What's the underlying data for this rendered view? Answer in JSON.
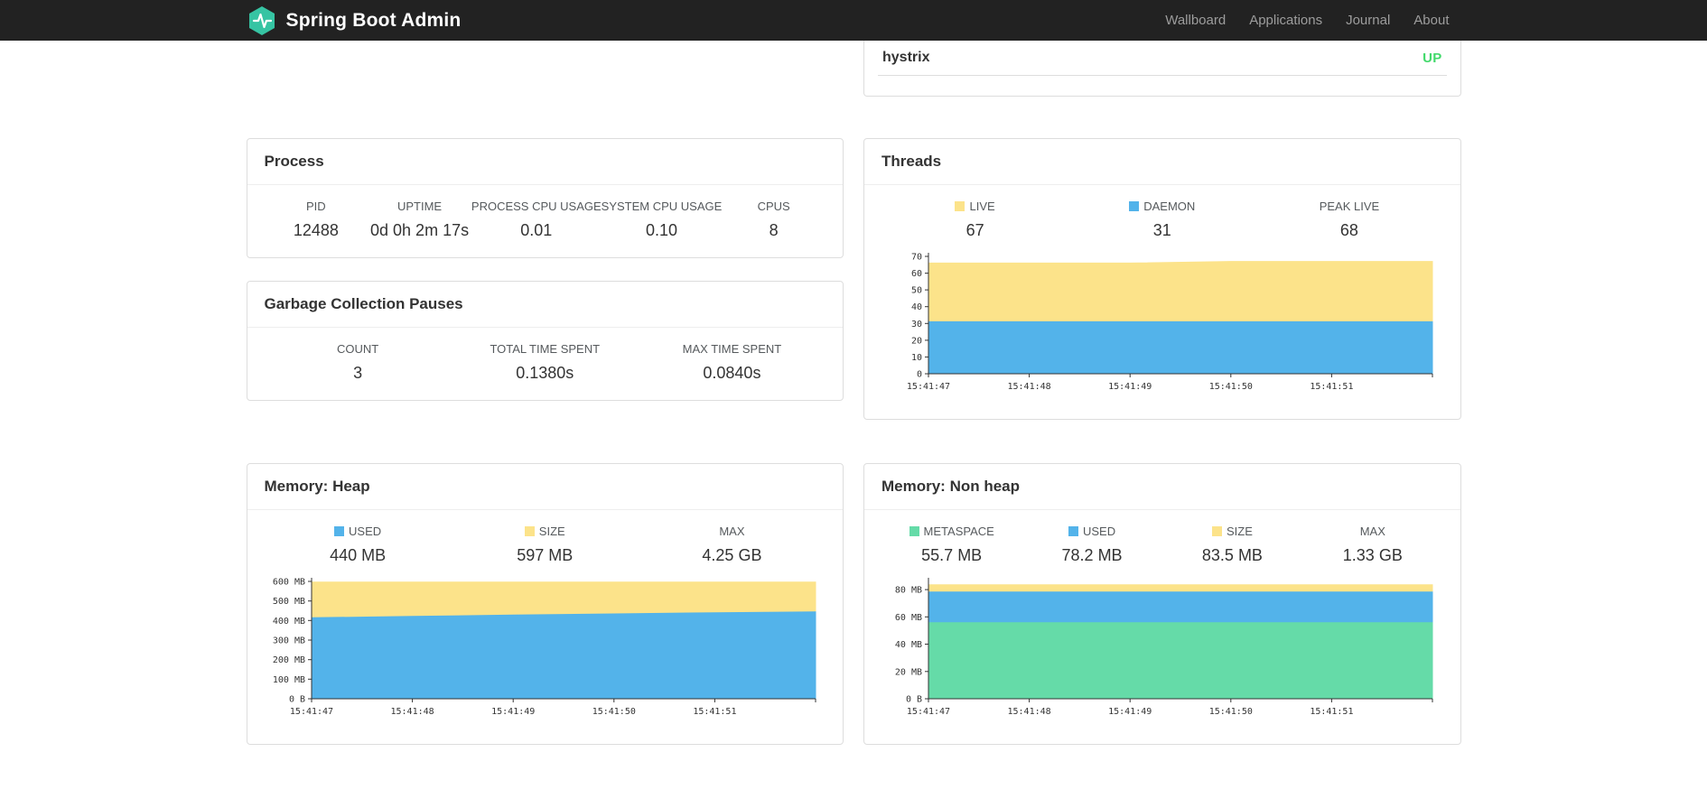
{
  "navbar": {
    "brand": "Spring Boot Admin",
    "logo_color": "#36c4a3",
    "items": [
      {
        "label": "Wallboard"
      },
      {
        "label": "Applications"
      },
      {
        "label": "Journal"
      },
      {
        "label": "About"
      }
    ]
  },
  "application_status": {
    "name": "hystrix",
    "status": "UP",
    "status_color": "#42d96b"
  },
  "cards": {
    "process": {
      "title": "Process",
      "metrics": [
        {
          "label": "PID",
          "value": "12488"
        },
        {
          "label": "UPTIME",
          "value": "0d 0h 2m 17s"
        },
        {
          "label": "PROCESS CPU USAGE",
          "value": "0.01"
        },
        {
          "label": "SYSTEM CPU USAGE",
          "value": "0.10"
        },
        {
          "label": "CPUS",
          "value": "8"
        }
      ]
    },
    "gc": {
      "title": "Garbage Collection Pauses",
      "metrics": [
        {
          "label": "COUNT",
          "value": "3"
        },
        {
          "label": "TOTAL TIME SPENT",
          "value": "0.1380s"
        },
        {
          "label": "MAX TIME SPENT",
          "value": "0.0840s"
        }
      ]
    },
    "threads": {
      "title": "Threads",
      "legend": [
        {
          "label": "LIVE",
          "value": "67",
          "color": "#fce38a"
        },
        {
          "label": "DAEMON",
          "value": "31",
          "color": "#53b3ea"
        },
        {
          "label": "PEAK LIVE",
          "value": "68"
        }
      ]
    },
    "heap": {
      "title": "Memory: Heap",
      "legend": [
        {
          "label": "USED",
          "value": "440 MB",
          "color": "#53b3ea"
        },
        {
          "label": "SIZE",
          "value": "597 MB",
          "color": "#fce38a"
        },
        {
          "label": "MAX",
          "value": "4.25 GB"
        }
      ]
    },
    "nonheap": {
      "title": "Memory: Non heap",
      "legend": [
        {
          "label": "METASPACE",
          "value": "55.7 MB",
          "color": "#65dba8"
        },
        {
          "label": "USED",
          "value": "78.2 MB",
          "color": "#53b3ea"
        },
        {
          "label": "SIZE",
          "value": "83.5 MB",
          "color": "#fce38a"
        },
        {
          "label": "MAX",
          "value": "1.33 GB"
        }
      ]
    }
  },
  "chart_data": [
    {
      "id": "threads",
      "type": "area",
      "title": "Threads",
      "xlabel": "",
      "ylabel": "",
      "ylim": [
        0,
        70
      ],
      "grid": false,
      "legend_position": "top",
      "x": [
        "15:41:47",
        "15:41:48",
        "15:41:49",
        "15:41:50",
        "15:41:51"
      ],
      "yticks": [
        {
          "v": 0,
          "label": "0"
        },
        {
          "v": 10,
          "label": "10"
        },
        {
          "v": 20,
          "label": "20"
        },
        {
          "v": 30,
          "label": "30"
        },
        {
          "v": 40,
          "label": "40"
        },
        {
          "v": 50,
          "label": "50"
        },
        {
          "v": 60,
          "label": "60"
        },
        {
          "v": 70,
          "label": "70"
        }
      ],
      "series": [
        {
          "name": "LIVE",
          "color": "#fce38a",
          "values": [
            66,
            66,
            66,
            67,
            67,
            67
          ]
        },
        {
          "name": "DAEMON",
          "color": "#53b3ea",
          "values": [
            31,
            31,
            31,
            31,
            31,
            31
          ]
        }
      ]
    },
    {
      "id": "heap",
      "type": "area",
      "title": "Memory: Heap",
      "xlabel": "",
      "ylabel": "",
      "ylim": [
        0,
        600
      ],
      "grid": false,
      "legend_position": "top",
      "x": [
        "15:41:47",
        "15:41:48",
        "15:41:49",
        "15:41:50",
        "15:41:51"
      ],
      "yticks": [
        {
          "v": 0,
          "label": "0 B"
        },
        {
          "v": 100,
          "label": "100 MB"
        },
        {
          "v": 200,
          "label": "200 MB"
        },
        {
          "v": 300,
          "label": "300 MB"
        },
        {
          "v": 400,
          "label": "400 MB"
        },
        {
          "v": 500,
          "label": "500 MB"
        },
        {
          "v": 600,
          "label": "600 MB"
        }
      ],
      "series": [
        {
          "name": "SIZE",
          "color": "#fce38a",
          "values": [
            597,
            597,
            597,
            597,
            597,
            597
          ]
        },
        {
          "name": "USED",
          "color": "#53b3ea",
          "values": [
            414,
            421,
            428,
            434,
            440,
            444
          ]
        }
      ]
    },
    {
      "id": "nonheap",
      "type": "area",
      "title": "Memory: Non heap",
      "xlabel": "",
      "ylabel": "",
      "ylim": [
        0,
        86
      ],
      "grid": false,
      "legend_position": "top",
      "x": [
        "15:41:47",
        "15:41:48",
        "15:41:49",
        "15:41:50",
        "15:41:51"
      ],
      "yticks": [
        {
          "v": 0,
          "label": "0 B"
        },
        {
          "v": 20,
          "label": "20 MB"
        },
        {
          "v": 40,
          "label": "40 MB"
        },
        {
          "v": 60,
          "label": "60 MB"
        },
        {
          "v": 80,
          "label": "80 MB"
        }
      ],
      "series": [
        {
          "name": "SIZE",
          "color": "#fce38a",
          "values": [
            83.5,
            83.5,
            83.5,
            83.5,
            83.5,
            83.5
          ]
        },
        {
          "name": "USED",
          "color": "#53b3ea",
          "values": [
            78.2,
            78.2,
            78.2,
            78.2,
            78.2,
            78.2
          ]
        },
        {
          "name": "METASPACE",
          "color": "#65dba8",
          "values": [
            55.7,
            55.7,
            55.7,
            55.7,
            55.7,
            55.7
          ]
        }
      ]
    }
  ]
}
